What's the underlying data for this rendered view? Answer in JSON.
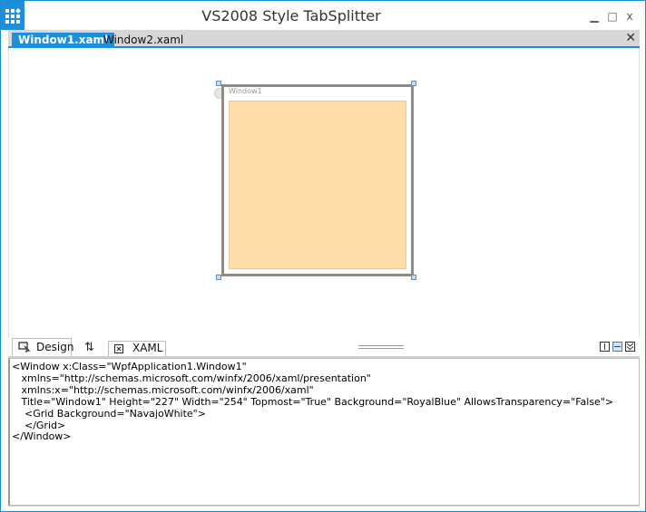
{
  "window": {
    "title": "VS2008 Style TabSplitter",
    "minimize_glyph": "▁",
    "maximize_glyph": "□",
    "close_glyph": "x",
    "accent_color": "#1e8fd8"
  },
  "doc_tabs": {
    "tabs": [
      {
        "label": "Window1.xaml",
        "active": true
      },
      {
        "label": "Window2.xaml",
        "active": false
      }
    ],
    "close_glyph": "✕"
  },
  "design_surface": {
    "window_title": "Window1",
    "grid_color": "#ffdeab"
  },
  "splitter": {
    "design_label": "Design",
    "xaml_label": "XAML",
    "swap_glyph": "⇅",
    "icons": [
      "design-view-icon",
      "swap-panes-icon",
      "xaml-view-icon",
      "vertical-split-icon",
      "horizontal-split-icon",
      "collapse-pane-icon"
    ]
  },
  "editor": {
    "lines": [
      "<Window x:Class=\"WpfApplication1.Window1\"",
      "   xmlns=\"http://schemas.microsoft.com/winfx/2006/xaml/presentation\"",
      "   xmlns:x=\"http://schemas.microsoft.com/winfx/2006/xaml\"",
      "   Title=\"Window1\" Height=\"227\" Width=\"254\" Topmost=\"True\" Background=\"RoyalBlue\" AllowsTransparency=\"False\">",
      "    <Grid Background=\"NavajoWhite\">",
      "",
      "    </Grid>",
      "</Window>"
    ]
  }
}
